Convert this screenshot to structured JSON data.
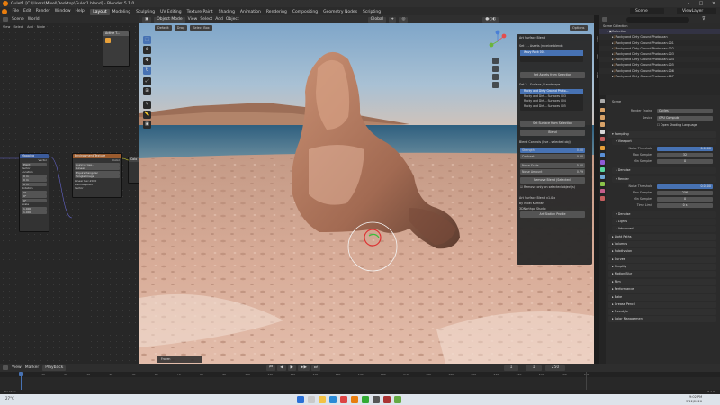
{
  "window": {
    "title": "Gulet1 [C:\\Users\\Mixel\\Desktop\\Gulet1.blend] - Blender 5.1.0"
  },
  "menus": [
    "File",
    "Edit",
    "Render",
    "Window",
    "Help"
  ],
  "workspaces": [
    "Layout",
    "Modeling",
    "Sculpting",
    "UV Editing",
    "Texture Paint",
    "Shading",
    "Animation",
    "Rendering",
    "Compositing",
    "Geometry Nodes",
    "Scripting"
  ],
  "active_workspace": "Layout",
  "scene_selector": {
    "scene": "Scene",
    "view_layer": "ViewLayer"
  },
  "node_editor": {
    "header": [
      "Scene",
      "World"
    ],
    "menus": [
      "View",
      "Select",
      "Add",
      "Node"
    ],
    "nodes": [
      {
        "title": "Mapping",
        "rows": [
          "Vector",
          "Type",
          "Point",
          "Vector",
          "Location",
          "X",
          "Y",
          "Z",
          "Rotation",
          "X",
          "Y",
          "Z",
          "Scale",
          "X",
          "Y",
          "Z"
        ],
        "values": [
          "0 m",
          "0 m",
          "0 m",
          "0°",
          "0°",
          "0°",
          "1.000",
          "1.000",
          "1.000"
        ]
      },
      {
        "title": "Environment Texture",
        "rows": [
          "Color",
          "Linear",
          "Equirectangular",
          "Single Image",
          "Color Space",
          "Linear Rec.2020",
          "Alpha",
          "Premultiplied",
          "Vector"
        ],
        "image": "sunny_rose..."
      }
    ]
  },
  "viewport": {
    "header": {
      "mode": "Object Mode",
      "menus": [
        "View",
        "Select",
        "Add",
        "Object"
      ],
      "orientation": "Global",
      "transform": "Default",
      "drag": "Drag",
      "select": "Select Box",
      "options": "Options"
    },
    "tools": [
      "cursor",
      "move",
      "rotate",
      "scale",
      "transform",
      "annotate",
      "measure",
      "add-cube"
    ],
    "footer_label": "Frozen"
  },
  "n_panel": {
    "header": "Art Surface Blend",
    "set1_label": "Set 1 - Assets (receive blend)",
    "set1_items": [
      "Wavy Rock 001"
    ],
    "set1_button": "Set Assets from Selection",
    "set2_label": "Set 2 - Surface / Landscape",
    "set2_items": [
      "Rocky and Dirty Ground Photo...",
      "Rocky and Dirt... Surfaces 003",
      "Rocky and Dirt... Surfaces 004",
      "Rocky and Dirt... Surfaces 005"
    ],
    "set2_button": "Set Surface from Selection",
    "blend_button": "Blend",
    "blend_controls_label": "Blend Controls (live - selected obj)",
    "fields": [
      {
        "label": "Strength",
        "value": "0.00"
      },
      {
        "label": "Contrast",
        "value": "0.00"
      },
      {
        "label": "Noise Scale",
        "value": "5.00"
      },
      {
        "label": "Noise Amount",
        "value": "0.79"
      }
    ],
    "remove_button": "Remove Blend (Selected)",
    "remove_check": "Remove only on selected object(s)",
    "info": [
      "Art Surface Blend v1.0.x",
      "by Mixel Kamran",
      "3DNorthpo Studio"
    ],
    "profile_button": "Art Station Profile"
  },
  "outliner": {
    "title": "Scene Collection",
    "rows": [
      "Collection",
      "Rocky and Dirty Ground Photoscan",
      "Rocky and Dirty Ground Photoscan.001",
      "Rocky and Dirty Ground Photoscan.002",
      "Rocky and Dirty Ground Photoscan.003",
      "Rocky and Dirty Ground Photoscan.004",
      "Rocky and Dirty Ground Photoscan.005",
      "Rocky and Dirty Ground Photoscan.006",
      "Rocky and Dirty Ground Photoscan.007"
    ]
  },
  "properties": {
    "crumb": "Scene",
    "render_engine": {
      "label": "Render Engine",
      "value": "Cycles"
    },
    "device": {
      "label": "Device",
      "value": "GPU Compute"
    },
    "open_shading": "Open Shading Language",
    "sampling": "Sampling",
    "viewport": "Viewport",
    "vp_fields": [
      {
        "label": "Noise Threshold",
        "value": "0.0100"
      },
      {
        "label": "Max Samples",
        "value": "32"
      },
      {
        "label": "Min Samples",
        "value": "0"
      }
    ],
    "denoise": "Denoise",
    "render": "Render",
    "r_fields": [
      {
        "label": "Noise Threshold",
        "value": "0.0100"
      },
      {
        "label": "Max Samples",
        "value": "256"
      },
      {
        "label": "Min Samples",
        "value": "0"
      },
      {
        "label": "Time Limit",
        "value": "0 s"
      }
    ],
    "sections": [
      "Denoise",
      "Lights",
      "Advanced",
      "Light Paths",
      "Volumes",
      "Subdivision",
      "Curves",
      "Simplify",
      "Motion Blur",
      "Film",
      "Performance",
      "Bake",
      "Grease Pencil",
      "Freestyle",
      "Color Management"
    ]
  },
  "timeline": {
    "menus": [
      "View",
      "Marker",
      "Playback"
    ],
    "current_frame": "1",
    "start": "1",
    "end": "250",
    "ticks": [
      "0",
      "10",
      "20",
      "30",
      "40",
      "50",
      "60",
      "70",
      "80",
      "90",
      "100",
      "110",
      "120",
      "130",
      "140",
      "150",
      "160",
      "170",
      "180",
      "190",
      "200",
      "210",
      "220",
      "230",
      "240",
      "250"
    ]
  },
  "status": {
    "left": "Pan View",
    "right": "5.1.0"
  },
  "taskbar": {
    "weather": "27°C",
    "time": "9:02 PM",
    "date": "3/12/2026"
  },
  "colors": {
    "accent": "#4772b3",
    "orange": "#e87d0d",
    "selected_green": "#8bc34a"
  }
}
